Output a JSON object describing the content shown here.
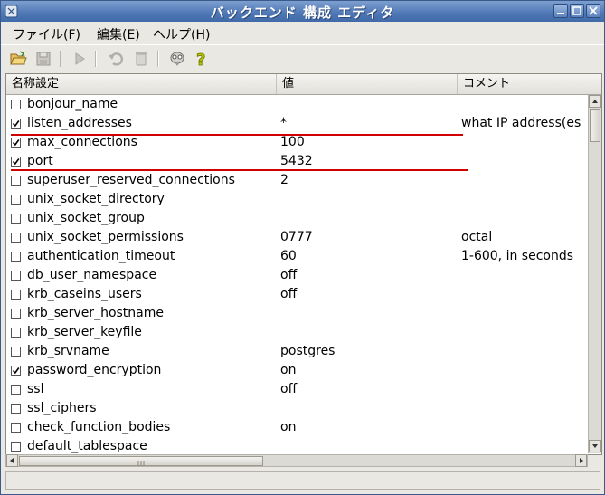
{
  "window": {
    "title": "バックエンド 構成 エディタ"
  },
  "menu": [
    {
      "label": "ファイル(F)"
    },
    {
      "label": "編集(E)"
    },
    {
      "label": "ヘルプ(H)"
    }
  ],
  "toolbar": {
    "icons": [
      "open-icon",
      "save-icon",
      "run-icon",
      "undo-icon",
      "delete-icon",
      "hint-icon",
      "help-icon"
    ]
  },
  "table": {
    "columns": [
      "名称設定",
      "値",
      "コメント"
    ],
    "rows": [
      {
        "checked": false,
        "name": "bonjour_name",
        "value": "",
        "comment": ""
      },
      {
        "checked": true,
        "name": "listen_addresses",
        "value": "*",
        "comment": "what IP address(es"
      },
      {
        "checked": true,
        "name": "max_connections",
        "value": "100",
        "comment": ""
      },
      {
        "checked": true,
        "name": "port",
        "value": "5432",
        "comment": ""
      },
      {
        "checked": false,
        "name": "superuser_reserved_connections",
        "value": "2",
        "comment": ""
      },
      {
        "checked": false,
        "name": "unix_socket_directory",
        "value": "",
        "comment": ""
      },
      {
        "checked": false,
        "name": "unix_socket_group",
        "value": "",
        "comment": ""
      },
      {
        "checked": false,
        "name": "unix_socket_permissions",
        "value": "0777",
        "comment": "octal"
      },
      {
        "checked": false,
        "name": "authentication_timeout",
        "value": "60",
        "comment": "1-600, in seconds"
      },
      {
        "checked": false,
        "name": "db_user_namespace",
        "value": "off",
        "comment": ""
      },
      {
        "checked": false,
        "name": "krb_caseins_users",
        "value": "off",
        "comment": ""
      },
      {
        "checked": false,
        "name": "krb_server_hostname",
        "value": "",
        "comment": ""
      },
      {
        "checked": false,
        "name": "krb_server_keyfile",
        "value": "",
        "comment": ""
      },
      {
        "checked": false,
        "name": "krb_srvname",
        "value": "postgres",
        "comment": ""
      },
      {
        "checked": true,
        "name": "password_encryption",
        "value": "on",
        "comment": ""
      },
      {
        "checked": false,
        "name": "ssl",
        "value": "off",
        "comment": ""
      },
      {
        "checked": false,
        "name": "ssl_ciphers",
        "value": "",
        "comment": ""
      },
      {
        "checked": false,
        "name": "check_function_bodies",
        "value": "on",
        "comment": ""
      },
      {
        "checked": false,
        "name": "default_tablespace",
        "value": "",
        "comment": ""
      }
    ]
  },
  "colors": {
    "titlebar": "#4f77b5",
    "highlight_line": "#d00000",
    "title_text": "#ffffff"
  }
}
